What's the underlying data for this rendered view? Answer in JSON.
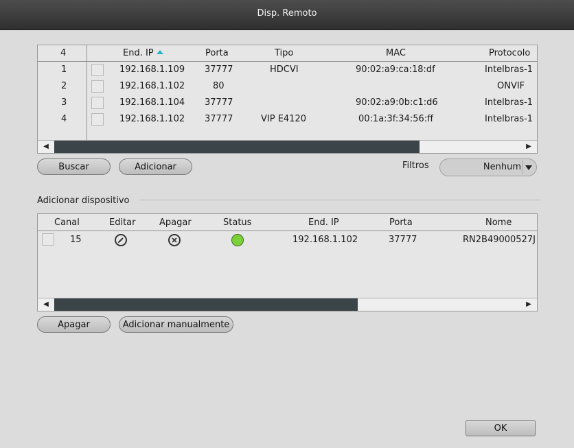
{
  "window": {
    "title": "Disp. Remoto"
  },
  "search_table": {
    "count_header": "4",
    "columns": [
      "End. IP",
      "Porta",
      "Tipo",
      "MAC",
      "Protocolo"
    ],
    "rows": [
      {
        "idx": "1",
        "ip": "192.168.1.109",
        "porta": "37777",
        "tipo": "HDCVI",
        "mac": "90:02:a9:ca:18:df",
        "protocolo": "Intelbras-1"
      },
      {
        "idx": "2",
        "ip": "192.168.1.102",
        "porta": "80",
        "tipo": "",
        "mac": "",
        "protocolo": "ONVIF"
      },
      {
        "idx": "3",
        "ip": "192.168.1.104",
        "porta": "37777",
        "tipo": "",
        "mac": "90:02:a9:0b:c1:d6",
        "protocolo": "Intelbras-1"
      },
      {
        "idx": "4",
        "ip": "192.168.1.102",
        "porta": "37777",
        "tipo": "VIP E4120",
        "mac": "00:1a:3f:34:56:ff",
        "protocolo": "Intelbras-1"
      }
    ]
  },
  "actions_top": {
    "buscar": "Buscar",
    "adicionar": "Adicionar"
  },
  "filter": {
    "label": "Filtros",
    "value": "Nenhum"
  },
  "added_section": {
    "title": "Adicionar dispositivo",
    "columns": [
      "Canal",
      "Editar",
      "Apagar",
      "Status",
      "End. IP",
      "Porta",
      "Nome"
    ],
    "rows": [
      {
        "canal": "15",
        "status_color": "#7cd03a",
        "ip": "192.168.1.102",
        "porta": "37777",
        "nome": "RN2B49000527J"
      }
    ]
  },
  "actions_bottom": {
    "apagar": "Apagar",
    "adicionar_manual": "Adicionar manualmente"
  },
  "footer": {
    "ok": "OK"
  },
  "icons": {
    "sort": "sort-ascending-icon",
    "edit": "pencil-icon",
    "delete": "close-circle-icon",
    "scroll_left": "arrow-left-icon",
    "scroll_right": "arrow-right-icon",
    "dropdown": "chevron-down-icon"
  }
}
